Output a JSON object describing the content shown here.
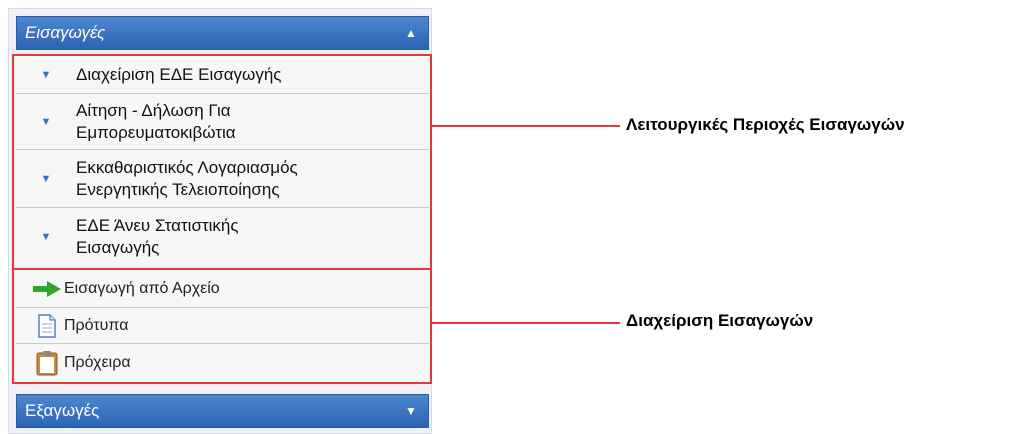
{
  "imports_header": {
    "label": "Εισαγωγές",
    "arrow": "▲"
  },
  "functional_items": [
    {
      "line1": "Διαχείριση ΕΔΕ Εισαγωγής",
      "line2": ""
    },
    {
      "line1": "Αίτηση - Δήλωση Για",
      "line2": "Εμπορευματοκιβώτια"
    },
    {
      "line1": "Εκκαθαριστικός Λογαριασμός",
      "line2": "Ενεργητικής Τελειοποίησης"
    },
    {
      "line1": "ΕΔΕ Άνευ Στατιστικής",
      "line2": "Εισαγωγής"
    }
  ],
  "tools": [
    {
      "label": "Εισαγωγή από Αρχείο",
      "icon": "green-arrow-icon"
    },
    {
      "label": "Πρότυπα",
      "icon": "document-icon"
    },
    {
      "label": "Πρόχειρα",
      "icon": "clipboard-icon"
    }
  ],
  "exports_header": {
    "label": "Εξαγωγές",
    "arrow": "▼"
  },
  "callouts": {
    "functional_areas": "Λειτουργικές Περιοχές Εισαγωγών",
    "import_management": "Διαχείριση Εισαγωγών"
  },
  "colors": {
    "header_blue": "#3a70c0",
    "highlight_red": "#e03a3a",
    "bullet_blue": "#3a6fc4"
  }
}
